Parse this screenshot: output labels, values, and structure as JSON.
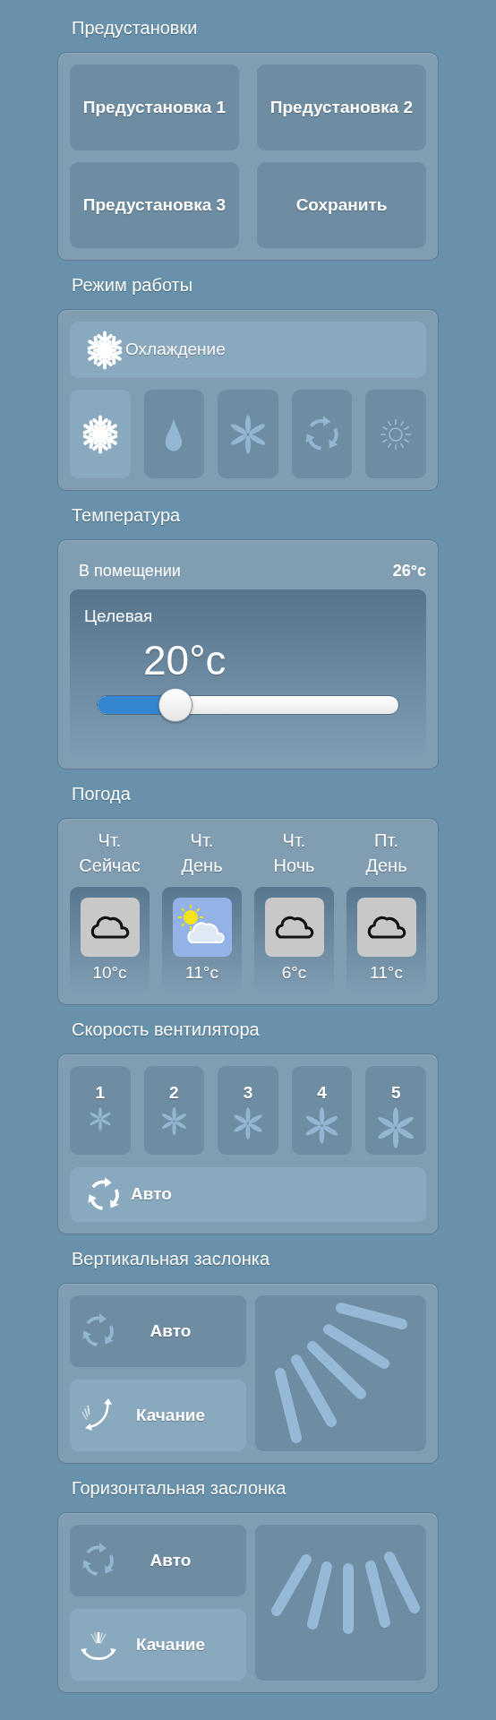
{
  "presets": {
    "title": "Предустановки",
    "buttons": [
      {
        "label": "Предустановка 1"
      },
      {
        "label": "Предустановка 2"
      },
      {
        "label": "Предустановка 3"
      },
      {
        "label": "Сохранить"
      }
    ]
  },
  "mode": {
    "title": "Режим работы",
    "current": {
      "label": "Охлаждение",
      "kind": "cool"
    },
    "options": [
      {
        "kind": "cool",
        "selected": true
      },
      {
        "kind": "dry",
        "selected": false
      },
      {
        "kind": "fan",
        "selected": false
      },
      {
        "kind": "auto",
        "selected": false
      },
      {
        "kind": "heat",
        "selected": false
      }
    ]
  },
  "temperature": {
    "title": "Температура",
    "indoor_label": "В помещении",
    "indoor_value": "26°c",
    "target_label": "Целевая",
    "target_value": "20°c",
    "level": 0.26
  },
  "weather": {
    "title": "Погода",
    "days": [
      {
        "day": "Чт.",
        "period": "Сейчас",
        "kind": "cloudy",
        "temp": "10°c"
      },
      {
        "day": "Чт.",
        "period": "День",
        "kind": "partly-cloudy",
        "temp": "11°c"
      },
      {
        "day": "Чт.",
        "period": "Ночь",
        "kind": "cloudy",
        "temp": "6°c"
      },
      {
        "day": "Пт.",
        "period": "День",
        "kind": "cloudy",
        "temp": "11°c"
      }
    ]
  },
  "fan_speed": {
    "title": "Скорость вентилятора",
    "speeds": [
      {
        "label": "1",
        "selected": false
      },
      {
        "label": "2",
        "selected": false
      },
      {
        "label": "3",
        "selected": false
      },
      {
        "label": "4",
        "selected": false
      },
      {
        "label": "5",
        "selected": false
      }
    ],
    "auto": {
      "label": "Авто",
      "selected": true
    }
  },
  "vertical_louver": {
    "title": "Вертикальная заслонка",
    "buttons": [
      {
        "kind": "auto",
        "label": "Авто",
        "selected": false
      },
      {
        "kind": "swing-vertical",
        "label": "Качание",
        "selected": true
      }
    ]
  },
  "horizontal_louver": {
    "title": "Горизонтальная заслонка",
    "buttons": [
      {
        "kind": "auto",
        "label": "Авто",
        "selected": false
      },
      {
        "kind": "swing-horizontal",
        "label": "Качание",
        "selected": true
      }
    ]
  }
}
